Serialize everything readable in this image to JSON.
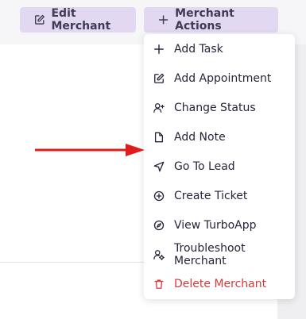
{
  "header": {
    "edit_button": {
      "label": "Edit Merchant",
      "icon": "edit-icon"
    },
    "actions_button": {
      "label": "Merchant Actions",
      "icon": "plus-icon"
    }
  },
  "menu": {
    "items": [
      {
        "label": "Add Task",
        "icon": "plus-icon"
      },
      {
        "label": "Add Appointment",
        "icon": "edit-icon"
      },
      {
        "label": "Change Status",
        "icon": "user-plus-icon"
      },
      {
        "label": "Add Note",
        "icon": "file-icon"
      },
      {
        "label": "Go To Lead",
        "icon": "navigation-icon"
      },
      {
        "label": "Create Ticket",
        "icon": "plus-circle-icon"
      },
      {
        "label": "View TurboApp",
        "icon": "compass-icon"
      },
      {
        "label": "Troubleshoot Merchant",
        "icon": "user-gear-icon"
      },
      {
        "label": "Delete Merchant",
        "icon": "trash-icon",
        "color": "#d63a3a"
      }
    ]
  },
  "colors": {
    "button_bg": "#e2d8f1",
    "button_text": "#3f3b57",
    "danger": "#d63a3a",
    "arrow": "#e01d1d"
  }
}
